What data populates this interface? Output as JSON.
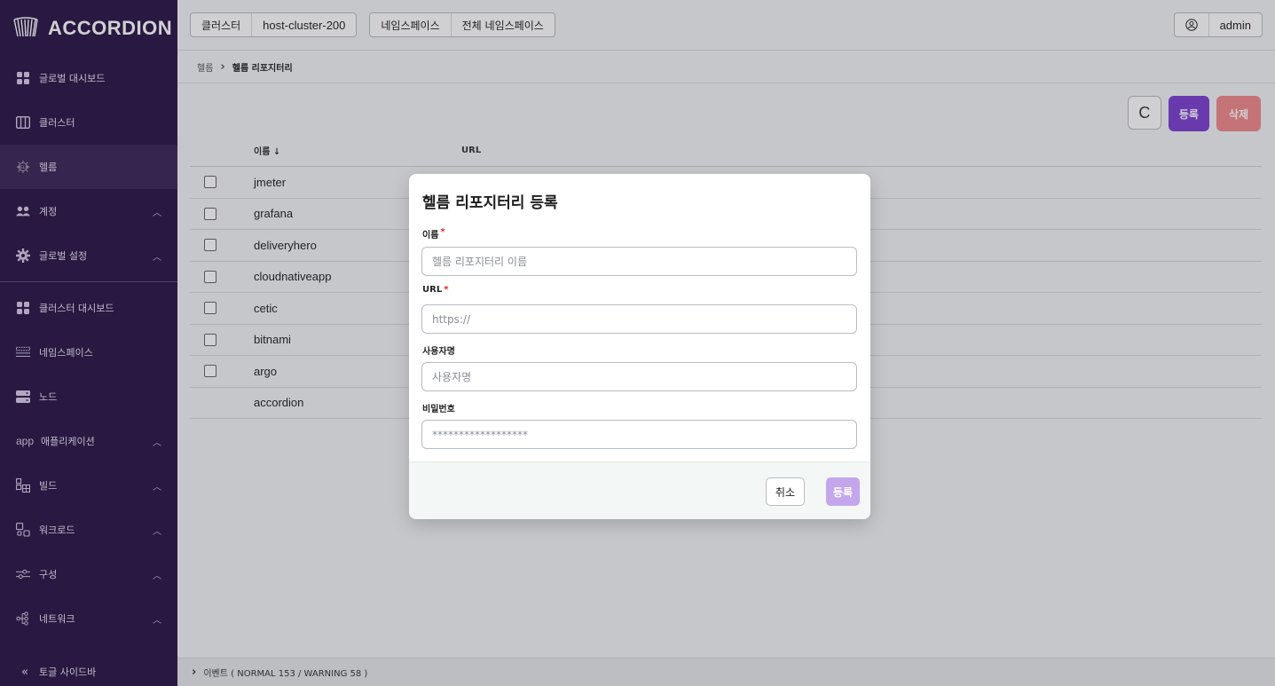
{
  "app": {
    "logo_text": "ACCORDION"
  },
  "sidebar": {
    "items": [
      {
        "label": "글로벌 대시보드",
        "icon": "grid-icon",
        "caret": ""
      },
      {
        "label": "클러스터",
        "icon": "columns-icon",
        "caret": ""
      },
      {
        "label": "헬름",
        "icon": "helm-icon",
        "caret": ""
      },
      {
        "label": "계정",
        "icon": "users-icon",
        "caret": "︿"
      },
      {
        "label": "글로벌 설정",
        "icon": "gear-icon",
        "caret": "︿"
      },
      {
        "label": "클러스터 대시보드",
        "icon": "grid-icon",
        "caret": ""
      },
      {
        "label": "네임스페이스",
        "icon": "namespace-icon",
        "caret": ""
      },
      {
        "label": "노드",
        "icon": "server-icon",
        "caret": ""
      },
      {
        "label": "애플리케이션",
        "icon": "app-icon",
        "icon_text": "app",
        "caret": "︿"
      },
      {
        "label": "빌드",
        "icon": "build-icon",
        "caret": "︿"
      },
      {
        "label": "워크로드",
        "icon": "workload-icon",
        "caret": "︿"
      },
      {
        "label": "구성",
        "icon": "sliders-icon",
        "caret": "︿"
      },
      {
        "label": "네트워크",
        "icon": "network-icon",
        "caret": "︿"
      }
    ],
    "toggle_label": "토글 사이드바",
    "toggle_icon_text": "«"
  },
  "topbar": {
    "cluster_label": "클러스터",
    "cluster_value": "host-cluster-200",
    "namespace_label": "네임스페이스",
    "namespace_value": "전체 네임스페이스",
    "user_name": "admin"
  },
  "breadcrumb": {
    "parent": "헬름",
    "separator": "›",
    "current": "헬름 리포지터리"
  },
  "actions": {
    "refresh_glyph": "C",
    "register_label": "등록",
    "delete_label": "삭제"
  },
  "table": {
    "columns": {
      "name": "이름 ↓",
      "url": "URL"
    },
    "rows": [
      {
        "name": "jmeter",
        "checkbox": true
      },
      {
        "name": "grafana",
        "checkbox": true
      },
      {
        "name": "deliveryhero",
        "checkbox": true
      },
      {
        "name": "cloudnativeapp",
        "checkbox": true
      },
      {
        "name": "cetic",
        "checkbox": true
      },
      {
        "name": "bitnami",
        "checkbox": true
      },
      {
        "name": "argo",
        "checkbox": true
      },
      {
        "name": "accordion",
        "checkbox": false
      }
    ]
  },
  "events": {
    "chevron": "›",
    "text": "이벤트 ( NORMAL 153 / WARNING 58 )"
  },
  "modal": {
    "title": "헬름 리포지터리 등록",
    "name_label": "이름",
    "name_placeholder": "헬름 리포지터리 이름",
    "url_label": "URL",
    "url_placeholder": "https://",
    "username_label": "사용자명",
    "username_placeholder": "사용자명",
    "password_label": "비밀번호",
    "password_placeholder": "******************",
    "required_mark": "*",
    "cancel_label": "취소",
    "submit_label": "등록"
  },
  "colors": {
    "sidebar_bg": "#2a1547",
    "primary": "#7a3fd1",
    "danger": "#f08a8a",
    "submit_disabled": "#c3a6ec"
  }
}
